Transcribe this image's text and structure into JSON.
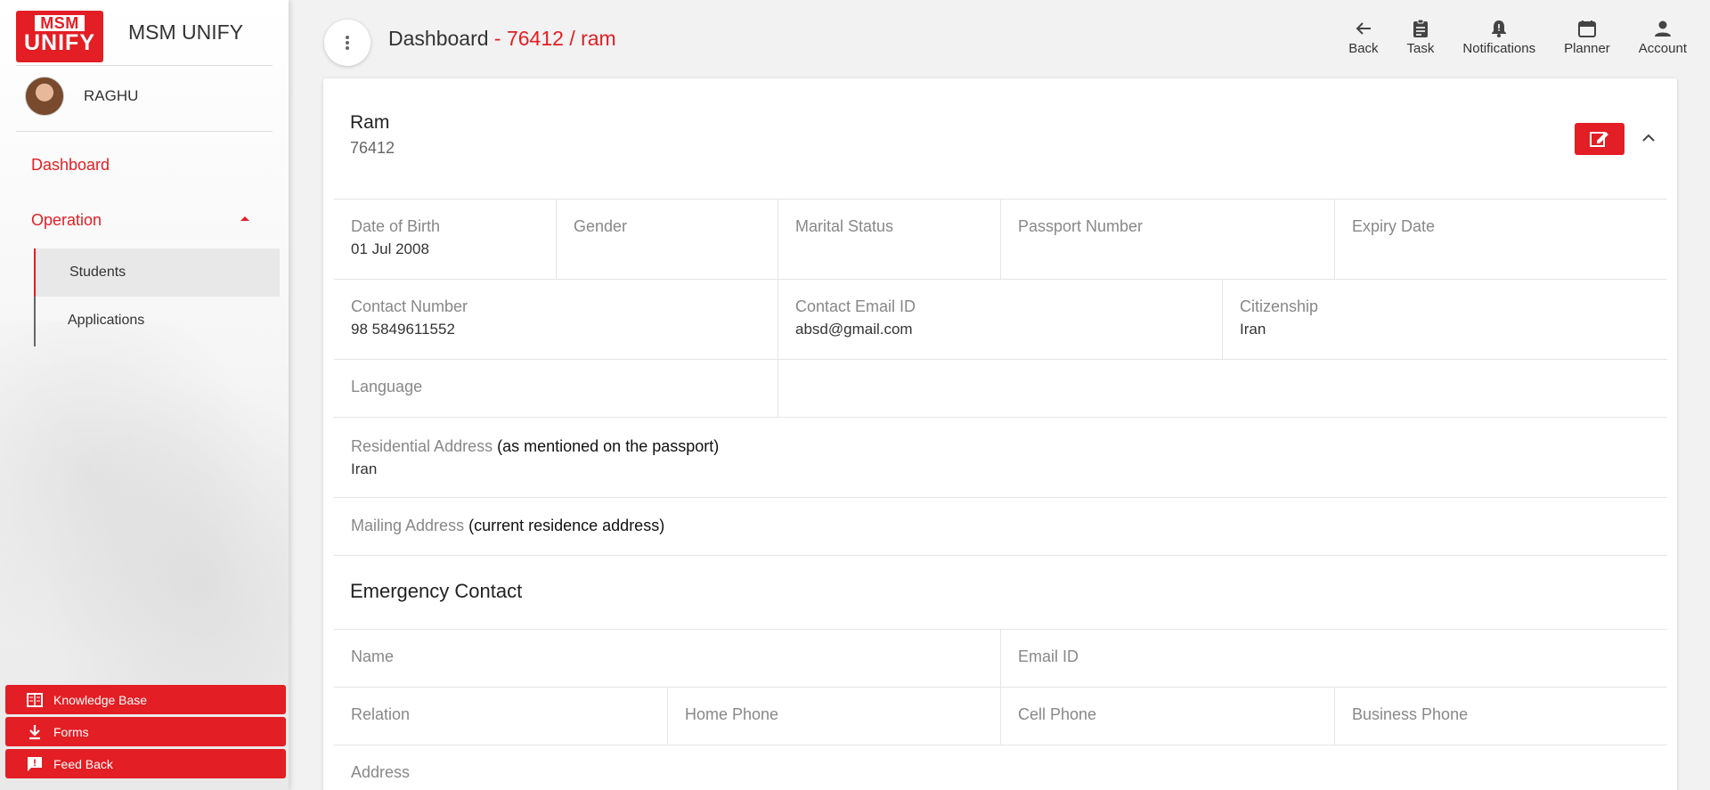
{
  "sidebar": {
    "logo_top": "MSM",
    "logo_bottom": "UNIFY",
    "brand": "MSM UNIFY",
    "user": "RAGHU",
    "nav": {
      "dashboard": "Dashboard",
      "operation": "Operation",
      "students": "Students",
      "applications": "Applications"
    },
    "bottom": {
      "knowledge_base": "Knowledge Base",
      "forms": "Forms",
      "feedback": "Feed Back"
    }
  },
  "header": {
    "title": "Dashboard",
    "breadcrumb": "- 76412 / ram",
    "actions": {
      "back": "Back",
      "task": "Task",
      "notifications": "Notifications",
      "planner": "Planner",
      "account": "Account"
    }
  },
  "student": {
    "name": "Ram",
    "id": "76412",
    "fields": {
      "dob_label": "Date of Birth",
      "dob": "01 Jul 2008",
      "gender_label": "Gender",
      "marital_label": "Marital Status",
      "passport_label": "Passport Number",
      "expiry_label": "Expiry Date",
      "contact_label": "Contact Number",
      "contact": "98 5849611552",
      "email_label": "Contact Email ID",
      "email": "absd@gmail.com",
      "citizenship_label": "Citizenship",
      "citizenship": "Iran",
      "language_label": "Language",
      "res_label": "Residential Address",
      "res_note": "(as mentioned on the passport)",
      "res": "Iran",
      "mail_label": "Mailing Address",
      "mail_note": "(current residence address)"
    },
    "emergency": {
      "title": "Emergency Contact",
      "name_label": "Name",
      "email_label": "Email ID",
      "relation_label": "Relation",
      "home_label": "Home Phone",
      "cell_label": "Cell Phone",
      "business_label": "Business Phone",
      "address_label": "Address"
    }
  },
  "colors": {
    "accent": "#e31e24"
  }
}
